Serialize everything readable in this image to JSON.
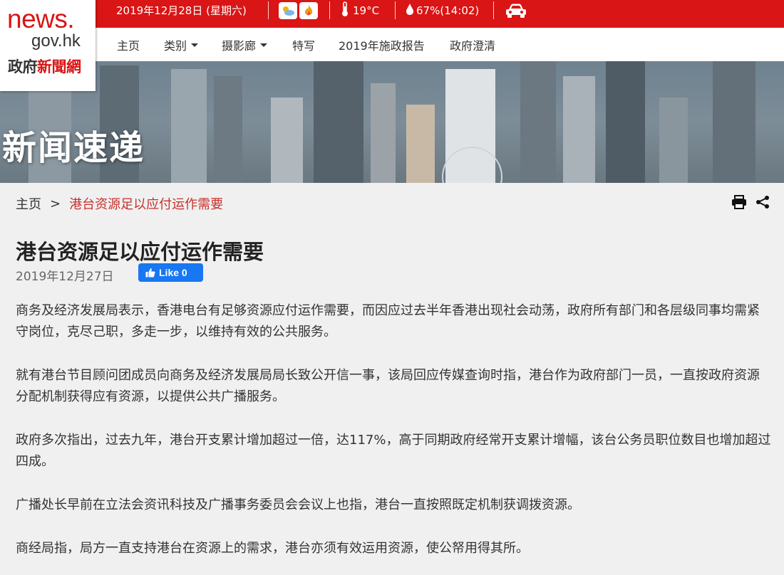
{
  "topbar": {
    "date": "2019年12月28日 (星期六)",
    "temperature": "19°C",
    "humidity": "67%(14:02)"
  },
  "logo": {
    "line1": "news.",
    "line2": "gov.hk",
    "line3_part1": "政府",
    "line3_part2": "新聞網"
  },
  "nav": {
    "items": [
      {
        "label": "主页"
      },
      {
        "label": "类别"
      },
      {
        "label": "摄影廊"
      },
      {
        "label": "特写"
      },
      {
        "label": "2019年施政报告"
      },
      {
        "label": "政府澄清"
      }
    ]
  },
  "banner": {
    "title": "新闻速递"
  },
  "breadcrumb": {
    "home": "主页",
    "separator": ">",
    "current": "港台资源足以应付运作需要"
  },
  "article": {
    "title": "港台资源足以应付运作需要",
    "date": "2019年12月27日",
    "like_label": "Like 0",
    "paragraphs": [
      "商务及经济发展局表示，香港电台有足够资源应付运作需要，而因应过去半年香港出现社会动荡，政府所有部门和各层级同事均需紧守岗位，克尽己职，多走一步，以维持有效的公共服务。",
      "就有港台节目顾问团成员向商务及经济发展局局长致公开信一事，该局回应传媒查询时指，港台作为政府部门一员，一直按政府资源分配机制获得应有资源，以提供公共广播服务。",
      "政府多次指出，过去九年，港台开支累计增加超过一倍，达117%，高于同期政府经常开支累计增幅，该台公务员职位数目也增加超过四成。",
      "广播处长早前在立法会资讯科技及广播事务委员会会议上也指，港台一直按照既定机制获调拨资源。",
      "商经局指，局方一直支持港台在资源上的需求，港台亦须有效运用资源，使公帑用得其所。"
    ]
  },
  "colors": {
    "brand_red": "#d91515",
    "link_red": "#c9302c",
    "facebook_blue": "#1877f2"
  },
  "icons": [
    "sun-cloud-icon",
    "fire-icon",
    "thermometer-icon",
    "droplet-icon",
    "car-icon",
    "print-icon",
    "share-icon",
    "thumbs-up-icon"
  ]
}
